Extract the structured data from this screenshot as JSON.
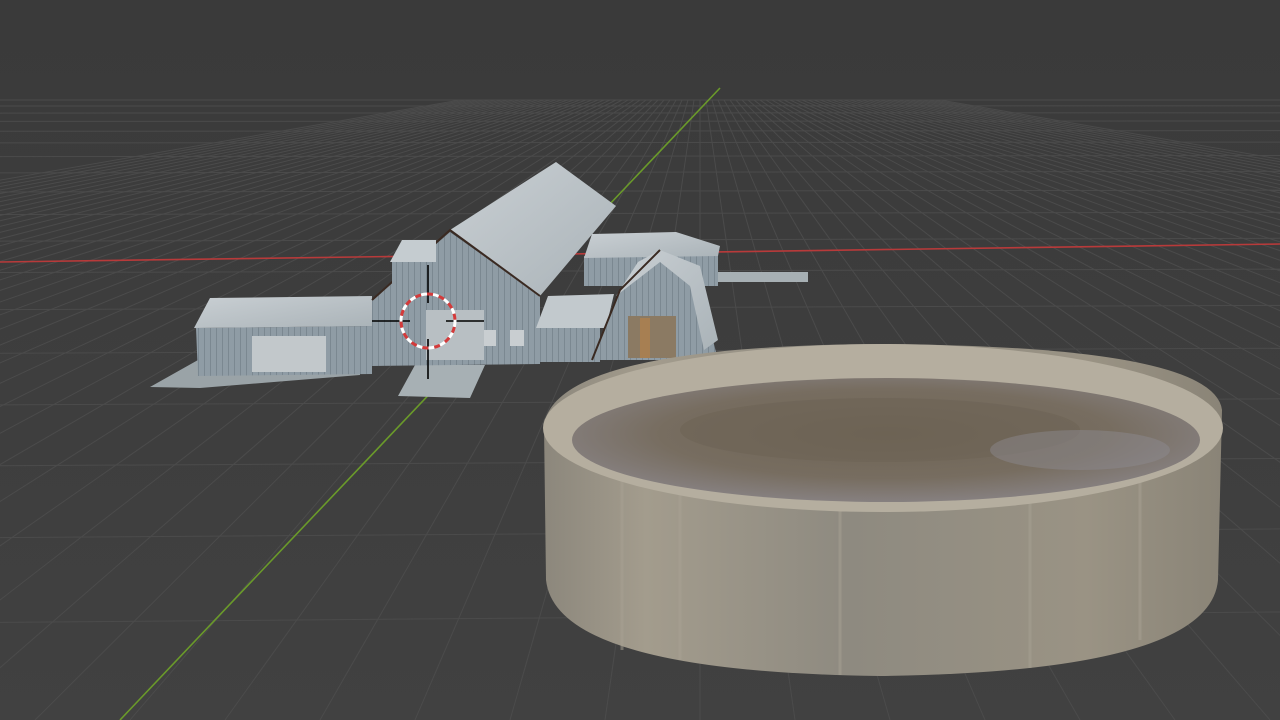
{
  "app": {
    "name": "3D Viewport"
  },
  "viewport": {
    "background": "#3d3d3d",
    "grid_color": "#4a4a4a",
    "x_axis_color": "#c0392b",
    "y_axis_color": "#6a9a2a"
  },
  "cursor": {
    "icon": "3d-cursor-icon",
    "ring_colors": [
      "#d43a3a",
      "#ffffff"
    ]
  },
  "objects": [
    {
      "id": "farmhouse",
      "label": "farmhouse",
      "material_color": "#8e9ba3"
    },
    {
      "id": "tank",
      "label": "circular-tank",
      "material_color": "#9c9486",
      "liquid_color": "#7a7064"
    }
  ]
}
